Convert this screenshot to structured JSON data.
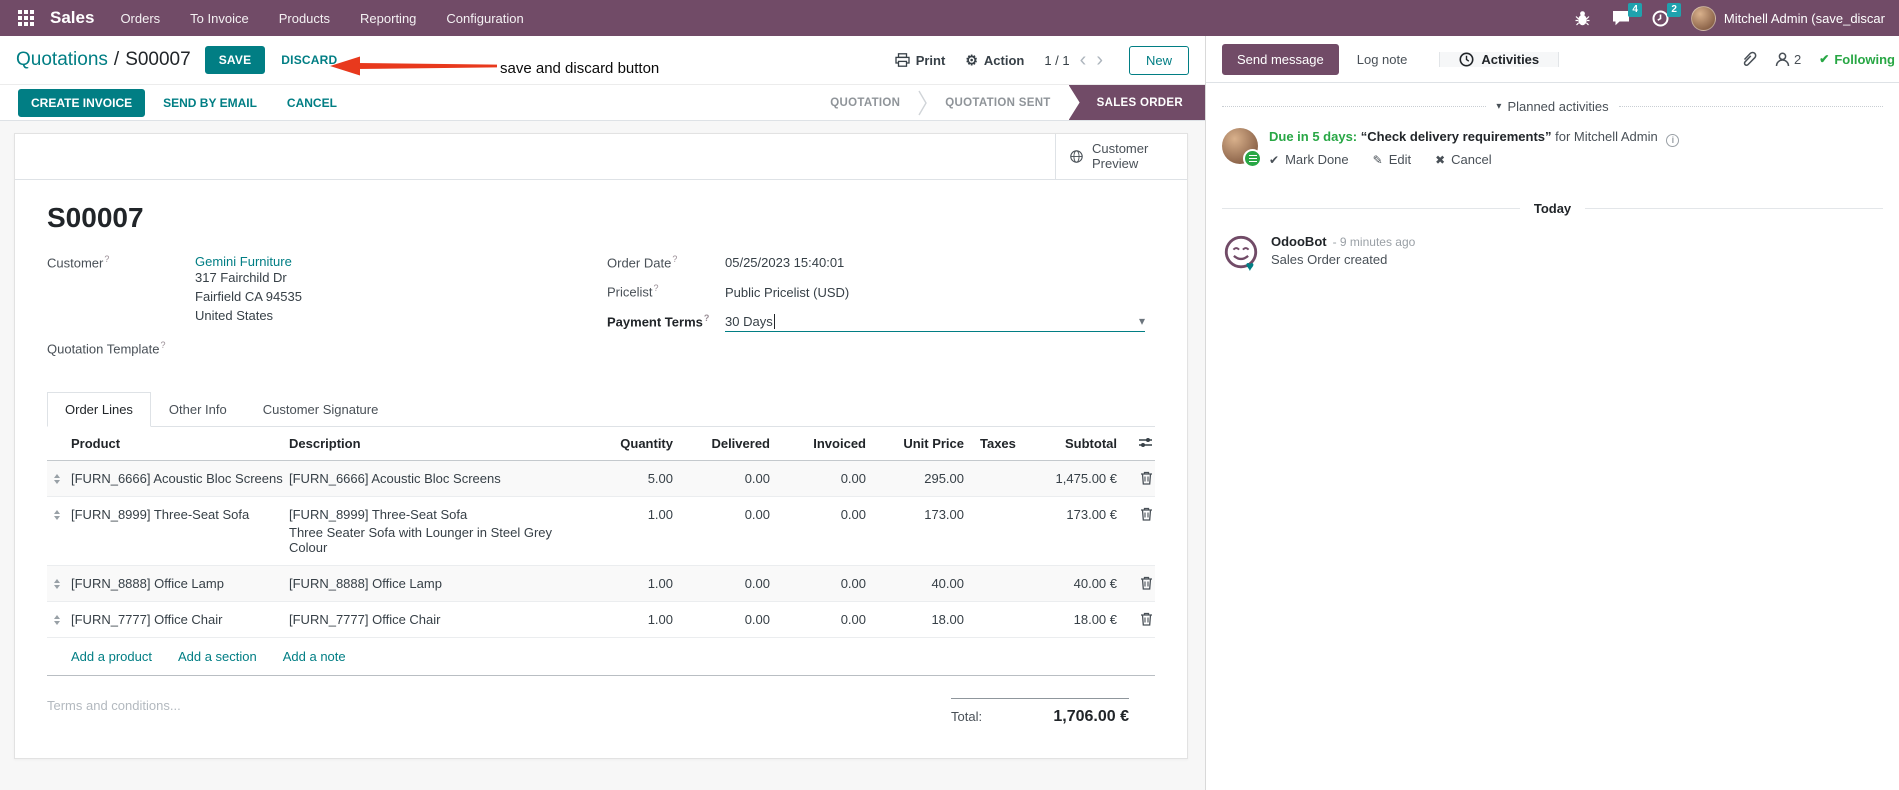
{
  "topbar": {
    "app_label": "Sales",
    "menu_items": [
      "Orders",
      "To Invoice",
      "Products",
      "Reporting",
      "Configuration"
    ],
    "messages_badge": "4",
    "activities_badge": "2",
    "user_name": "Mitchell Admin (save_discar"
  },
  "control_panel": {
    "breadcrumb_parent": "Quotations",
    "breadcrumb_separator": "/",
    "breadcrumb_current": "S00007",
    "save_label": "SAVE",
    "discard_label": "DISCARD",
    "annotation_text": "save and discard button",
    "print_label": "Print",
    "action_label": "Action",
    "pager_value": "1 / 1",
    "new_label": "New"
  },
  "statusbar": {
    "create_invoice_label": "CREATE INVOICE",
    "send_by_email_label": "SEND BY EMAIL",
    "cancel_label": "CANCEL",
    "steps": [
      {
        "label": "QUOTATION"
      },
      {
        "label": "QUOTATION SENT"
      },
      {
        "label": "SALES ORDER"
      }
    ],
    "active_step": "SALES ORDER"
  },
  "sheet": {
    "customer_preview_label": "Customer Preview",
    "order_ref": "S00007",
    "customer": {
      "label": "Customer",
      "name": "Gemini Furniture",
      "address_lines": [
        "317 Fairchild Dr",
        "Fairfield CA 94535",
        "United States"
      ]
    },
    "quotation_template_label": "Quotation Template",
    "order_date": {
      "label": "Order Date",
      "value": "05/25/2023 15:40:01"
    },
    "pricelist": {
      "label": "Pricelist",
      "value": "Public Pricelist (USD)"
    },
    "payment_terms": {
      "label": "Payment Terms",
      "value": "30 Days"
    },
    "tabs": [
      {
        "label": "Order Lines"
      },
      {
        "label": "Other Info"
      },
      {
        "label": "Customer Signature"
      }
    ],
    "active_tab": "Order Lines",
    "order_lines": {
      "headers": [
        "Product",
        "Description",
        "Quantity",
        "Delivered",
        "Invoiced",
        "Unit Price",
        "Taxes",
        "Subtotal"
      ],
      "rows": [
        {
          "product": "[FURN_6666] Acoustic Bloc Screens",
          "description": "[FURN_6666] Acoustic Bloc Screens",
          "description_note": "",
          "quantity": "5.00",
          "delivered": "0.00",
          "invoiced": "0.00",
          "unit_price": "295.00",
          "taxes": "",
          "subtotal": "1,475.00 €"
        },
        {
          "product": "[FURN_8999] Three-Seat Sofa",
          "description": "[FURN_8999] Three-Seat Sofa",
          "description_note": "Three Seater Sofa with Lounger in Steel Grey Colour",
          "quantity": "1.00",
          "delivered": "0.00",
          "invoiced": "0.00",
          "unit_price": "173.00",
          "taxes": "",
          "subtotal": "173.00 €"
        },
        {
          "product": "[FURN_8888] Office Lamp",
          "description": "[FURN_8888] Office Lamp",
          "description_note": "",
          "quantity": "1.00",
          "delivered": "0.00",
          "invoiced": "0.00",
          "unit_price": "40.00",
          "taxes": "",
          "subtotal": "40.00 €"
        },
        {
          "product": "[FURN_7777] Office Chair",
          "description": "[FURN_7777] Office Chair",
          "description_note": "",
          "quantity": "1.00",
          "delivered": "0.00",
          "invoiced": "0.00",
          "unit_price": "18.00",
          "taxes": "",
          "subtotal": "18.00 €"
        }
      ],
      "add_links": [
        "Add a product",
        "Add a section",
        "Add a note"
      ]
    },
    "terms_placeholder": "Terms and conditions...",
    "total": {
      "label": "Total:",
      "value": "1,706.00 €"
    }
  },
  "chatter": {
    "send_message_label": "Send message",
    "log_note_label": "Log note",
    "activities_label": "Activities",
    "followers_count": "2",
    "following_label": "Following",
    "planned_activities": {
      "header": "Planned activities",
      "items": [
        {
          "due_text": "Due in 5 days:",
          "summary": "“Check delivery requirements”",
          "assignee_text": "for Mitchell Admin",
          "mark_done_label": "Mark Done",
          "edit_label": "Edit",
          "cancel_label": "Cancel"
        }
      ]
    },
    "date_divider": "Today",
    "messages": [
      {
        "author": "OdooBot",
        "timestamp": "- 9 minutes ago",
        "body": "Sales Order created"
      }
    ]
  },
  "icons": {
    "gear": "⚙",
    "chevron_left": "‹",
    "chevron_right": "›",
    "caret_down": "▾",
    "check": "✔",
    "pencil": "✎",
    "cross": "✖",
    "heart": "♥"
  },
  "colors": {
    "brand_purple": "#714B67",
    "accent_teal": "#017E84",
    "badge_teal": "#1FA2AE",
    "activity_green": "#28a745",
    "annotation_red": "#E8391D"
  }
}
